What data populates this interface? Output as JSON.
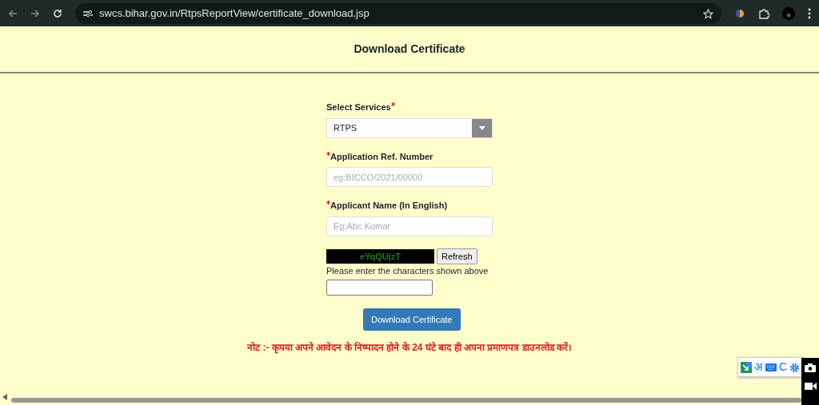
{
  "browser": {
    "url": "swcs.bihar.gov.in/RtpsReportView/certificate_download.jsp"
  },
  "page_title": "Download Certificate",
  "form": {
    "service": {
      "label": "Select Services",
      "required": true,
      "value": "RTPS"
    },
    "fields": [
      {
        "label": "Application Ref. Number",
        "required": true,
        "placeholder": "eg:BICCO/2021/00000"
      },
      {
        "label": "Applicant Name (In English)",
        "required": true,
        "placeholder": "Eg:Abc Kumar"
      }
    ],
    "captcha": {
      "code": "eYqQUjzT",
      "refresh": "Refresh",
      "hint": "Please enter the characters shown above"
    },
    "submit": "Download Certificate"
  },
  "note": "नोट :- कृपया अपने आवेदन के निष्पादन होने के **24** घंटे बाद ही अपना प्रमाणपत्र डाउनलोड करें।",
  "input_tools": {
    "language": "अ",
    "letter": "C"
  }
}
